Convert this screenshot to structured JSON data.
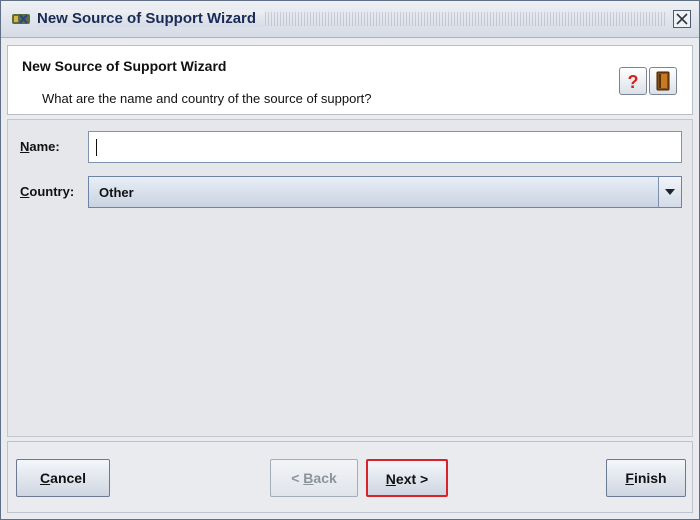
{
  "window": {
    "title": "New Source of Support Wizard",
    "icon": "app-wizard-icon",
    "close_icon": "close-icon"
  },
  "header": {
    "title": "New Source of Support Wizard",
    "subtitle": "What are the name and country of the source of support?",
    "help_icon": "help-icon",
    "book_icon": "book-icon"
  },
  "form": {
    "name": {
      "label": "ame:",
      "mnemonic": "N",
      "value": ""
    },
    "country": {
      "label": "ountry:",
      "mnemonic": "C",
      "value": "Other"
    }
  },
  "buttons": {
    "cancel": {
      "mnemonic": "C",
      "rest": "ancel"
    },
    "back": {
      "prefix": "< ",
      "mnemonic": "B",
      "rest": "ack"
    },
    "next": {
      "mnemonic": "N",
      "rest": "ext >",
      "highlight_color": "#d8232a"
    },
    "finish": {
      "mnemonic": "F",
      "rest": "inish"
    }
  }
}
